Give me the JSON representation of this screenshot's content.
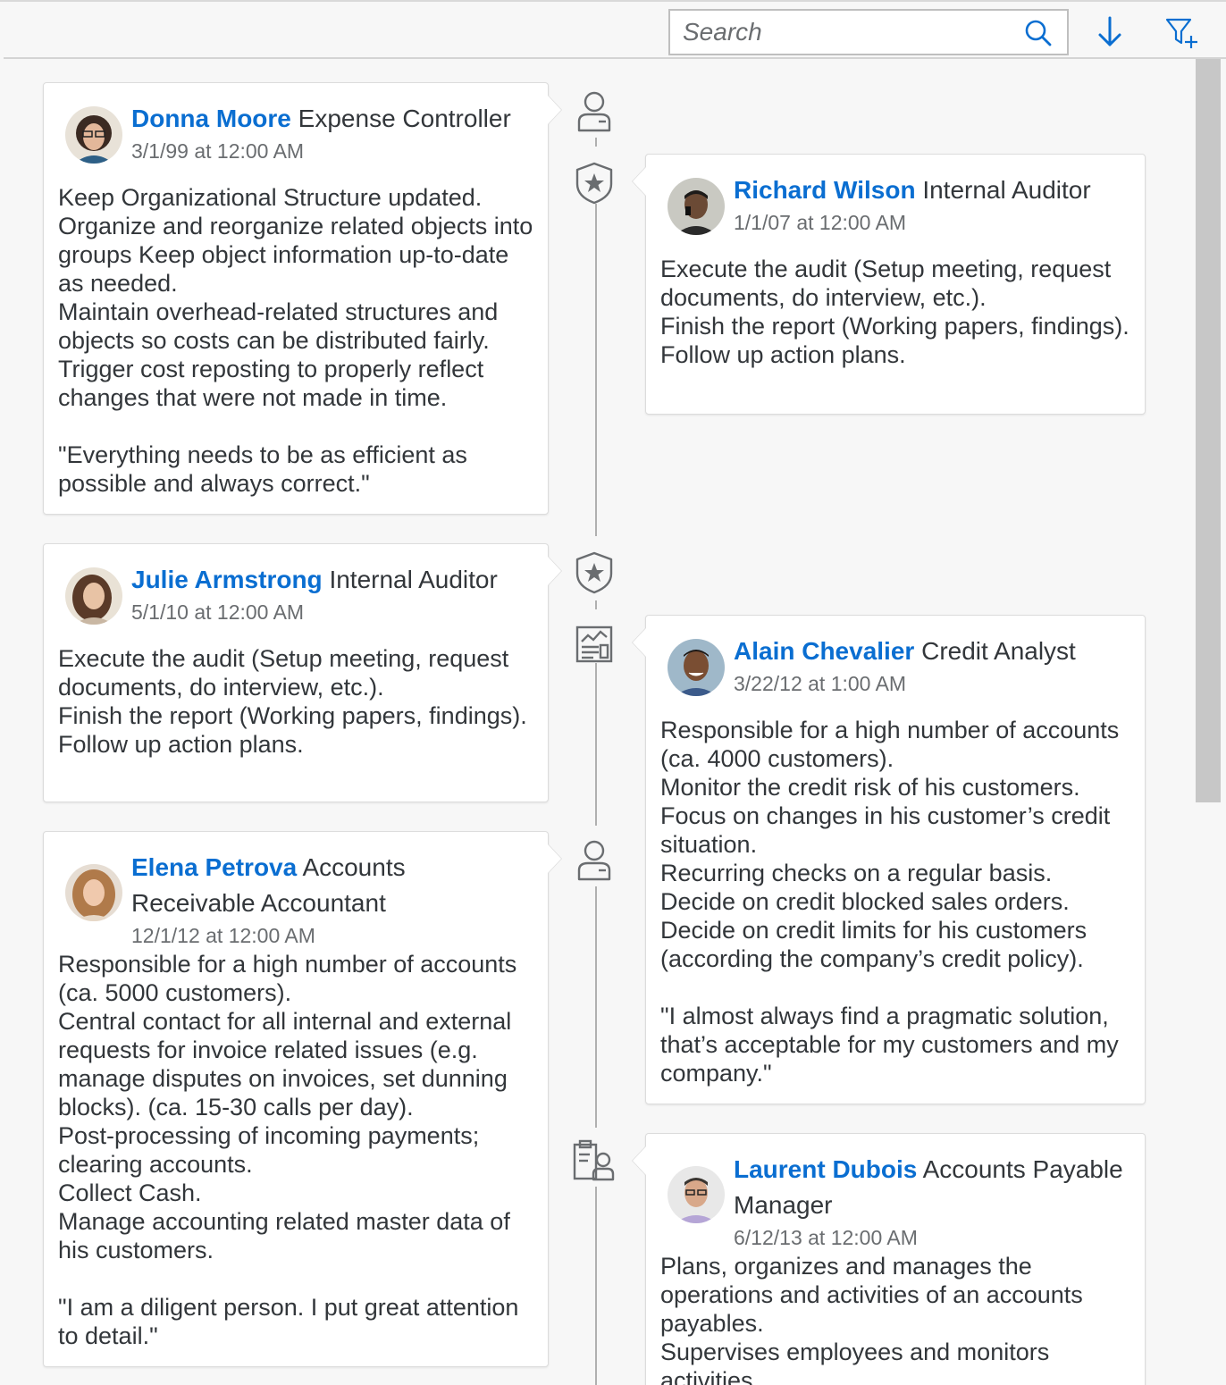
{
  "toolbar": {
    "search_placeholder": "Search",
    "search_icon": "search-icon",
    "sort_icon": "sort-descending-icon",
    "filter_icon": "add-filter-icon"
  },
  "colors": {
    "link": "#0a6ed1",
    "text": "#32363a",
    "subtle": "#6a6d70",
    "background": "#f7f7f7",
    "axis": "#b0b0b0"
  },
  "timeline": {
    "items": [
      {
        "name": "Donna Moore",
        "role": "Expense Controller",
        "date": "3/1/99 at 12:00 AM",
        "icon": "employee-icon",
        "text": "Keep Organizational Structure updated. Organize and reorganize related objects into groups Keep object information up-to-date as needed.\nMaintain overhead-related structures and objects so costs can be distributed fairly.\nTrigger cost reposting to properly reflect changes that were not made in time.\n\n\"Everything needs to be as efficient as possible and always correct.\""
      },
      {
        "name": "Richard Wilson",
        "role": "Internal Auditor",
        "date": "1/1/07 at 12:00 AM",
        "icon": "badge-star-icon",
        "text": "Execute the audit (Setup meeting, request documents, do interview, etc.).\nFinish the report (Working papers, findings).\nFollow up action plans."
      },
      {
        "name": "Julie Armstrong",
        "role": "Internal Auditor",
        "date": "5/1/10 at 12:00 AM",
        "icon": "badge-star-icon",
        "text": "Execute the audit (Setup meeting, request documents, do interview, etc.).\nFinish the report (Working papers, findings).\nFollow up action plans."
      },
      {
        "name": "Alain Chevalier",
        "role": "Credit Analyst",
        "date": "3/22/12 at 1:00 AM",
        "icon": "report-chart-icon",
        "text": "Responsible for a high number of accounts (ca. 4000 customers).\nMonitor the credit risk of his customers.\nFocus on changes in his customer’s credit situation.\nRecurring checks on a regular basis.\nDecide on credit blocked sales orders.\nDecide on credit limits for his customers (according the company’s credit policy).\n\n\"I almost always find a pragmatic solution, that’s acceptable for my customers and my company.\""
      },
      {
        "name": "Elena Petrova",
        "role": "Accounts Receivable Accountant",
        "date": "12/1/12 at 12:00 AM",
        "icon": "employee-icon",
        "text": "Responsible for a high number of accounts (ca. 5000 customers).\nCentral contact for all internal and external requests for invoice related issues (e.g. manage disputes on invoices, set dunning blocks). (ca. 15-30 calls per day).\nPost-processing of incoming payments; clearing accounts.\nCollect Cash.\nManage accounting related master data of his customers.\n\n\"I am a diligent person. I put great attention to detail.\""
      },
      {
        "name": "Laurent Dubois",
        "role": "Accounts Payable Manager",
        "date": "6/12/13 at 12:00 AM",
        "icon": "manager-clipboard-icon",
        "text": "Plans, organizes and manages the operations and activities of an accounts payables.\nSupervises employees and monitors activities."
      }
    ]
  }
}
